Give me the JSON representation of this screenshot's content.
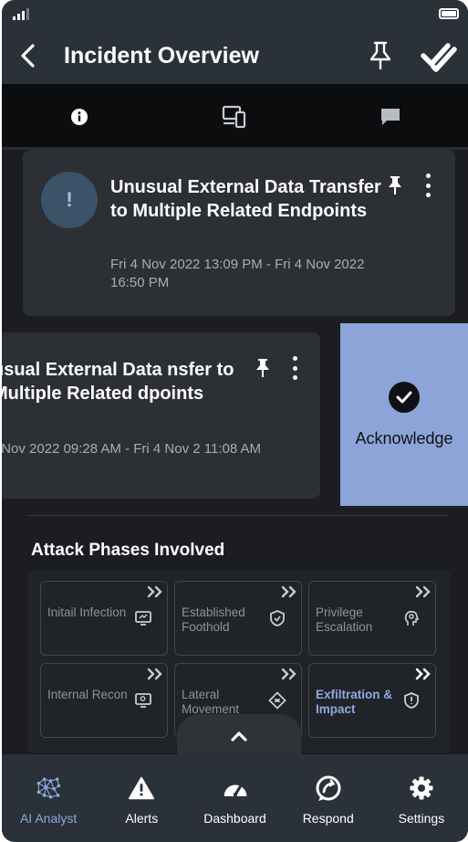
{
  "header": {
    "title": "Incident Overview"
  },
  "cards": [
    {
      "title": "Unusual External Data Transfer to Multiple Related Endpoints",
      "date": "Fri 4 Nov 2022 13:09 PM - Fri 4 Nov 2022 16:50 PM",
      "badge": "!"
    },
    {
      "title": "usual External Data nsfer to Multiple Related dpoints",
      "date": "- Nov 2022 09:28 AM - Fri 4 Nov 2 11:08 AM"
    }
  ],
  "acknowledge": {
    "label": "Acknowledge"
  },
  "attack_phases": {
    "title": "Attack Phases Involved",
    "items": [
      {
        "label": "Initail Infection",
        "icon": "monitor-icon"
      },
      {
        "label": "Established Foothold",
        "icon": "shield-icon"
      },
      {
        "label": "Privilege Escalation",
        "icon": "head-gear-icon"
      },
      {
        "label": "Internal Recon",
        "icon": "monitor-search-icon"
      },
      {
        "label": "Lateral Movement",
        "icon": "diamond-icon"
      },
      {
        "label": "Exfiltration & Impact",
        "icon": "shield-alert-icon",
        "highlighted": true
      }
    ]
  },
  "bottom_nav": [
    {
      "label": "AI Analyst",
      "icon": "network-icon",
      "active": true
    },
    {
      "label": "Alerts",
      "icon": "warning-icon"
    },
    {
      "label": "Dashboard",
      "icon": "gauge-icon"
    },
    {
      "label": "Respond",
      "icon": "respond-icon"
    },
    {
      "label": "Settings",
      "icon": "gear-icon"
    }
  ],
  "colors": {
    "accent": "#8da4d9",
    "background": "#1b1d21",
    "card": "#2c2f34",
    "header": "#2a3138"
  }
}
